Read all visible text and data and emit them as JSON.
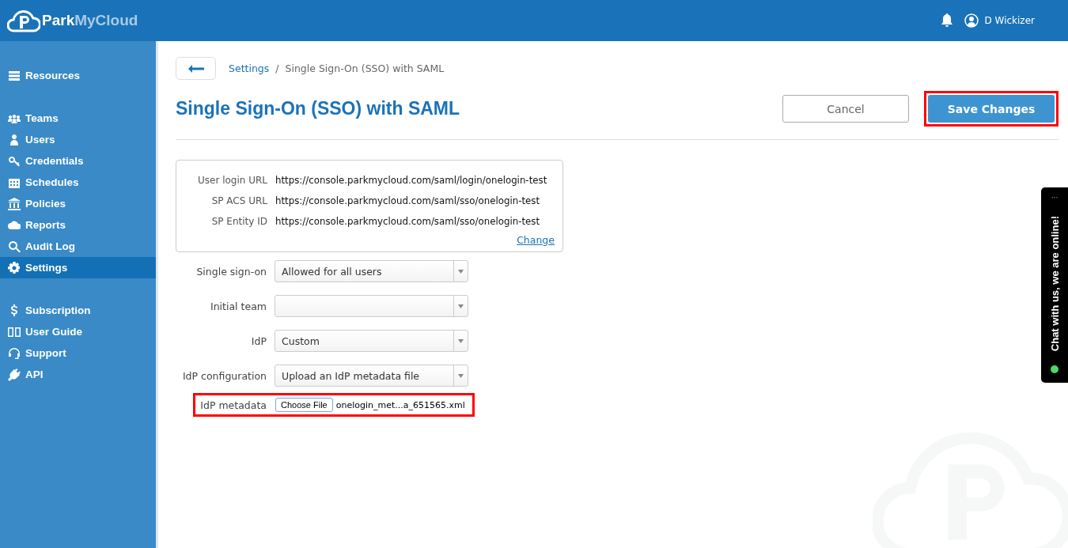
{
  "header": {
    "logo_primary": "Park",
    "logo_secondary": "MyCloud",
    "user": "D Wickizer"
  },
  "sidebar": {
    "groups": [
      [
        {
          "label": "Resources",
          "selected": false
        }
      ],
      [
        {
          "label": "Teams",
          "selected": false
        },
        {
          "label": "Users",
          "selected": false
        },
        {
          "label": "Credentials",
          "selected": false
        },
        {
          "label": "Schedules",
          "selected": false
        },
        {
          "label": "Policies",
          "selected": false
        },
        {
          "label": "Reports",
          "selected": false
        },
        {
          "label": "Audit Log",
          "selected": false
        },
        {
          "label": "Settings",
          "selected": true
        }
      ],
      [
        {
          "label": "Subscription",
          "selected": false
        },
        {
          "label": "User Guide",
          "selected": false
        },
        {
          "label": "Support",
          "selected": false
        },
        {
          "label": "API",
          "selected": false
        }
      ]
    ]
  },
  "breadcrumb": {
    "link": "Settings",
    "separator": "/",
    "current": "Single Sign-On (SSO) with SAML"
  },
  "title": "Single Sign-On (SSO) with SAML",
  "buttons": [
    {
      "label": "Cancel",
      "kind": "secondary",
      "highlighted": false
    },
    {
      "label": "Save Changes",
      "kind": "primary",
      "highlighted": true
    }
  ],
  "info": {
    "rows": [
      {
        "label": "User login URL",
        "value": "https://console.parkmycloud.com/saml/login/onelogin-test"
      },
      {
        "label": "SP ACS URL",
        "value": "https://console.parkmycloud.com/saml/sso/onelogin-test"
      },
      {
        "label": "SP Entity ID",
        "value": "https://console.parkmycloud.com/saml/sso/onelogin-test"
      }
    ],
    "link": "Change"
  },
  "form": [
    {
      "label": "Single sign-on",
      "kind": "select",
      "value": "Allowed for all users",
      "highlighted": false
    },
    {
      "label": "Initial team",
      "kind": "select",
      "highlighted": false
    },
    {
      "label": "IdP",
      "kind": "select",
      "value": "Custom",
      "highlighted": false
    },
    {
      "label": "IdP configuration",
      "kind": "select",
      "value": "Upload an IdP metadata file",
      "highlighted": false
    },
    {
      "label": "IdP metadata",
      "kind": "file",
      "button": "Choose File",
      "value": "onelogin_met...a_651565.xml",
      "highlighted": true
    }
  ],
  "chat": {
    "label": "Chat with us, we are online!",
    "menu": "···"
  }
}
